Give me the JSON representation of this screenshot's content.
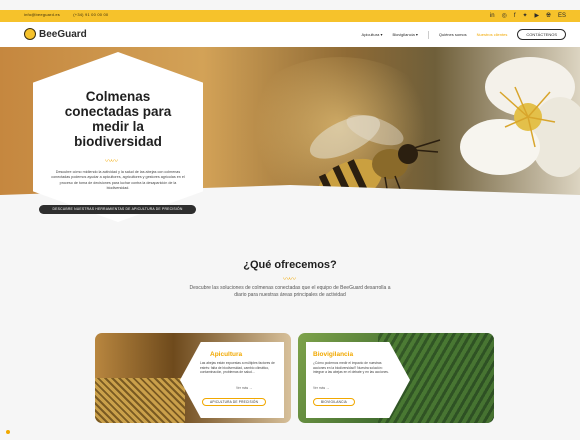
{
  "topbar": {
    "email": "info@beeguard.es",
    "phone": "(+34) 91 00 00 00",
    "social_icons": [
      "linkedin-icon",
      "instagram-icon",
      "facebook-icon",
      "twitter-icon",
      "youtube-icon",
      "globe-icon"
    ],
    "language": "ES"
  },
  "nav": {
    "logo": "BeeGuard",
    "items": [
      {
        "label": "Apicultura",
        "caret": "▾"
      },
      {
        "label": "Biovigilancia",
        "caret": "▾"
      },
      {
        "label": "Quiénes somos"
      },
      {
        "label": "Nuestros clientes"
      }
    ],
    "cta": "CONTÁCTENOS"
  },
  "hero": {
    "title": "Colmenas conectadas para medir la biodiversidad",
    "squiggle": "〰〰",
    "description": "Descubre cómo midiendo la actividad y la salud de las abejas con colmenas conectadas podemos ayudar a apicultores, agricultores y gestores agrícolas en el proceso de toma de decisiones para luchar contra la desaparición de la biodiversidad.",
    "button": "DESCUBRE NUESTRAS HERRAMIENTAS DE APICULTURA DE PRECISIÓN"
  },
  "offer": {
    "title": "¿Qué ofrecemos?",
    "squiggle": "〰〰",
    "description": "Descubre las soluciones de colmenas conectadas que el equipo de BeeGuard desarrolla a diario para nuestras áreas principales de actividad"
  },
  "cards": [
    {
      "title": "Apicultura",
      "description": "Las abejas están expuestas a múltiples factores de estrés: falta de biodiversidad, cambio climático, contaminación, problemas de salud...",
      "more": "Ver más →",
      "button": "APICULTURA DE PRECISIÓN"
    },
    {
      "title": "Biovigilancia",
      "description": "¿Cómo podemos medir el impacto de nuestras acciones en la biodiversidad? Nuestra solución: integrar a las abejas en el debate y en las acciones.",
      "more": "Ver más →",
      "button": "BIOVIGILANCIA"
    }
  ],
  "colors": {
    "accent": "#f6c22b",
    "accent_text": "#f1a800",
    "dark": "#2e2e2e"
  }
}
